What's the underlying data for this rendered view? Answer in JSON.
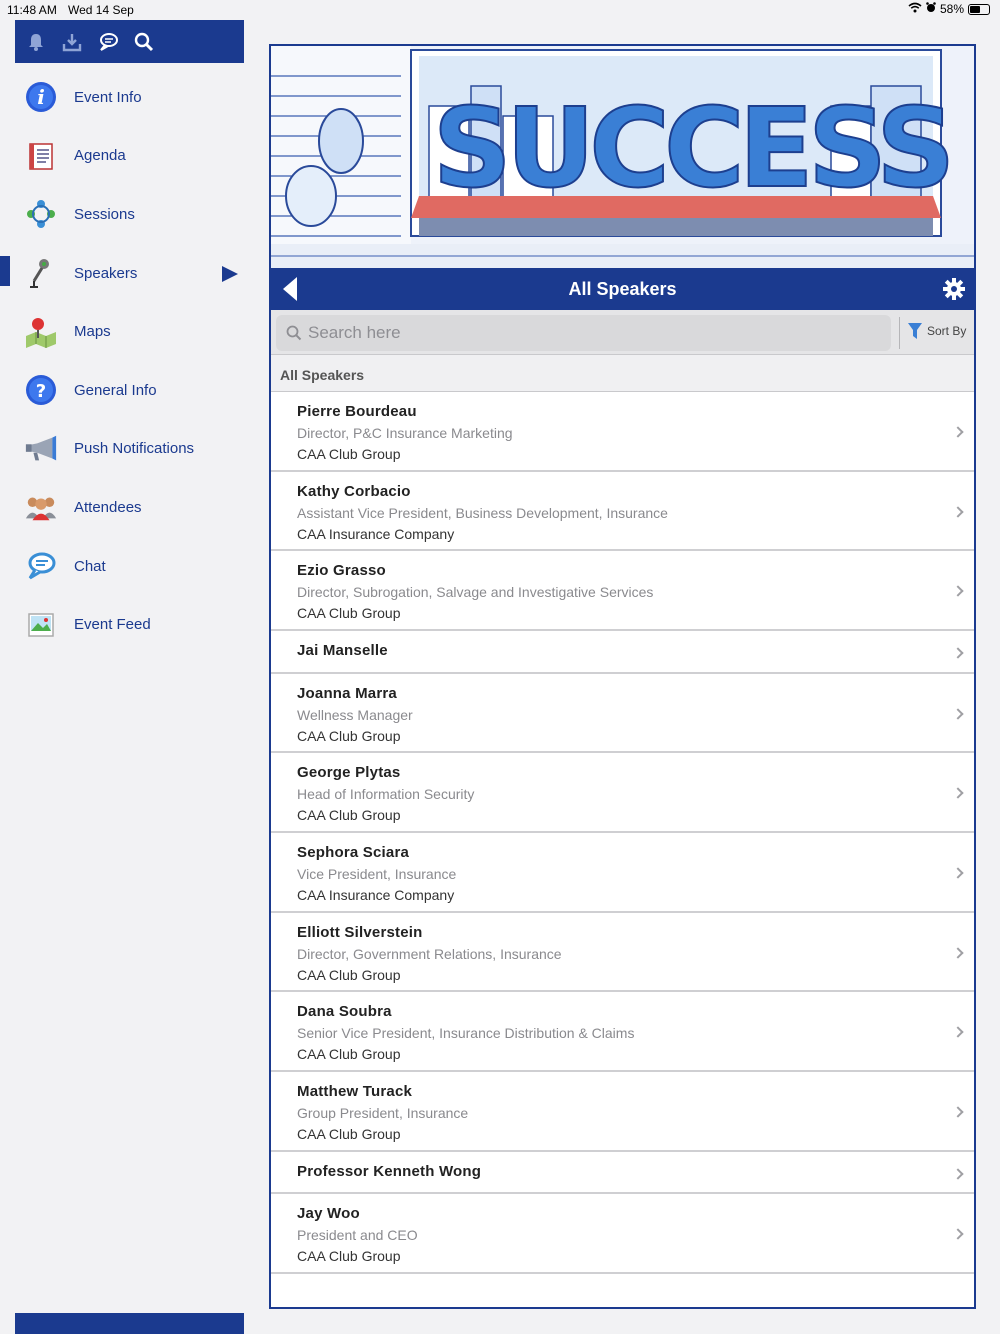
{
  "status": {
    "time": "11:48 AM",
    "date": "Wed 14 Sep",
    "battery": "58%",
    "battery_level": 0.58
  },
  "toolbar": {
    "icons": [
      "bell-icon",
      "download-icon",
      "chat-bubbles-icon",
      "search-icon"
    ]
  },
  "sidebar": {
    "items": [
      {
        "label": "Event Info",
        "icon": "info-icon"
      },
      {
        "label": "Agenda",
        "icon": "agenda-icon"
      },
      {
        "label": "Sessions",
        "icon": "sessions-icon"
      },
      {
        "label": "Speakers",
        "icon": "microphone-icon",
        "active": true
      },
      {
        "label": "Maps",
        "icon": "map-icon"
      },
      {
        "label": "General Info",
        "icon": "question-icon"
      },
      {
        "label": "Push Notifications",
        "icon": "megaphone-icon"
      },
      {
        "label": "Attendees",
        "icon": "people-icon"
      },
      {
        "label": "Chat",
        "icon": "chat-icon"
      },
      {
        "label": "Event Feed",
        "icon": "photo-icon"
      }
    ]
  },
  "banner": {
    "image": "success-city-banner"
  },
  "header": {
    "title": "All Speakers"
  },
  "search": {
    "placeholder": "Search here",
    "sort_label": "Sort By"
  },
  "section": {
    "title": "All Speakers"
  },
  "speakers": [
    {
      "name": "Pierre  Bourdeau",
      "title": "Director, P&C Insurance Marketing",
      "company": "CAA Club Group"
    },
    {
      "name": "Kathy  Corbacio",
      "title": "Assistant Vice President, Business Development, Insurance",
      "company": "CAA Insurance Company"
    },
    {
      "name": "Ezio  Grasso",
      "title": "Director, Subrogation, Salvage and Investigative Services",
      "company": "CAA Club Group"
    },
    {
      "name": "Jai  Manselle",
      "title": "",
      "company": ""
    },
    {
      "name": "Joanna  Marra",
      "title": "Wellness Manager",
      "company": "CAA Club Group"
    },
    {
      "name": "George  Plytas",
      "title": "Head of Information Security",
      "company": "CAA Club Group"
    },
    {
      "name": "Sephora  Sciara",
      "title": "Vice President, Insurance",
      "company": "CAA Insurance Company"
    },
    {
      "name": "Elliott  Silverstein",
      "title": "Director, Government Relations, Insurance",
      "company": "CAA Club Group"
    },
    {
      "name": "Dana  Soubra",
      "title": "Senior Vice President, Insurance Distribution & Claims",
      "company": "CAA Club Group"
    },
    {
      "name": "Matthew  Turack",
      "title": "Group President, Insurance",
      "company": "CAA Club Group"
    },
    {
      "name": "Professor Kenneth  Wong",
      "title": "",
      "company": ""
    },
    {
      "name": "Jay  Woo",
      "title": "President and CEO",
      "company": "CAA Club Group"
    }
  ],
  "colors": {
    "brand": "#1b3a8f",
    "background": "#f2f2f4"
  }
}
